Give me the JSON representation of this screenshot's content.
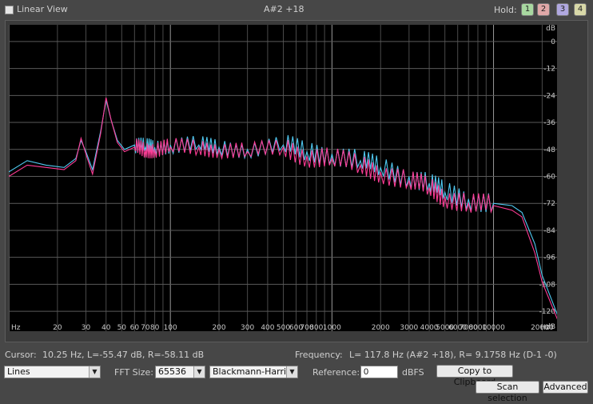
{
  "top": {
    "linear_view_label": "Linear View",
    "note": "A#2 +18",
    "hold_label": "Hold:",
    "hold_buttons": [
      {
        "label": "1",
        "color": "#a8d8a0"
      },
      {
        "label": "2",
        "color": "#e0a8a8"
      },
      {
        "label": "3",
        "color": "#b0a8e0"
      },
      {
        "label": "4",
        "color": "#d8d8a8"
      }
    ]
  },
  "chart_data": {
    "type": "line",
    "x_scale": "log",
    "xlim": [
      10,
      25000
    ],
    "ylim": [
      -126,
      6
    ],
    "x_tick_labels": [
      "Hz",
      "20",
      "30",
      "40",
      "50",
      "60",
      "70",
      "80",
      "100",
      "200",
      "300",
      "400",
      "500",
      "600",
      "700",
      "800",
      "1000",
      "2000",
      "3000",
      "4000",
      "5000",
      "6000",
      "7000",
      "8000",
      "10000",
      "20000",
      "Hz"
    ],
    "y_tick_labels": [
      "dB",
      "0",
      "-12",
      "-24",
      "-36",
      "-48",
      "-60",
      "-72",
      "-84",
      "-96",
      "-108",
      "-120",
      "dB"
    ],
    "series": [
      {
        "color": "#4fc8f0",
        "x": [
          10,
          13,
          17,
          22,
          26,
          28,
          30,
          33,
          37,
          40,
          43,
          47,
          52,
          60,
          70,
          80,
          100,
          150,
          200,
          300,
          500,
          700,
          1000,
          1500,
          2000,
          3000,
          4000,
          5000,
          7000,
          10000,
          13000,
          15000,
          18000,
          20000,
          25000
        ],
        "y": [
          -58,
          -53,
          -55,
          -56,
          -52,
          -44,
          -49,
          -57,
          -40,
          -26,
          -35,
          -44,
          -48,
          -46,
          -47,
          -47,
          -46,
          -46,
          -47,
          -48,
          -46,
          -49,
          -50,
          -53,
          -56,
          -60,
          -63,
          -67,
          -70,
          -72,
          -73,
          -76,
          -90,
          -104,
          -122
        ]
      },
      {
        "color": "#ff3c96",
        "x": [
          10,
          13,
          17,
          22,
          26,
          28,
          30,
          33,
          37,
          40,
          43,
          47,
          52,
          60,
          70,
          80,
          100,
          150,
          200,
          300,
          500,
          700,
          1000,
          1500,
          2000,
          3000,
          4000,
          5000,
          7000,
          10000,
          13000,
          15000,
          18000,
          20000,
          25000
        ],
        "y": [
          -60,
          -55,
          -56,
          -57,
          -53,
          -43,
          -50,
          -59,
          -41,
          -25,
          -35,
          -45,
          -49,
          -47,
          -48,
          -48,
          -47,
          -47,
          -48,
          -49,
          -47,
          -51,
          -52,
          -55,
          -58,
          -62,
          -65,
          -69,
          -72,
          -73,
          -75,
          -78,
          -94,
          -107,
          -124
        ]
      }
    ]
  },
  "status": {
    "cursor_label": "Cursor:",
    "cursor_value": "10.25 Hz, L=-55.47 dB, R=-58.11 dB",
    "frequency_label": "Frequency:",
    "frequency_value": "L=  117.8 Hz (A#2 +18), R= 9.1758 Hz (D-1 -0)"
  },
  "controls": {
    "style_value": "Lines",
    "fft_size_label": "FFT Size:",
    "fft_size_value": "65536",
    "window_value": "Blackmann-Harris",
    "reference_label": "Reference:",
    "reference_value": "0",
    "reference_unit": "dBFS",
    "copy_button": "Copy to Clipboard",
    "scan_button": "Scan selection",
    "advanced_button": "Advanced"
  }
}
